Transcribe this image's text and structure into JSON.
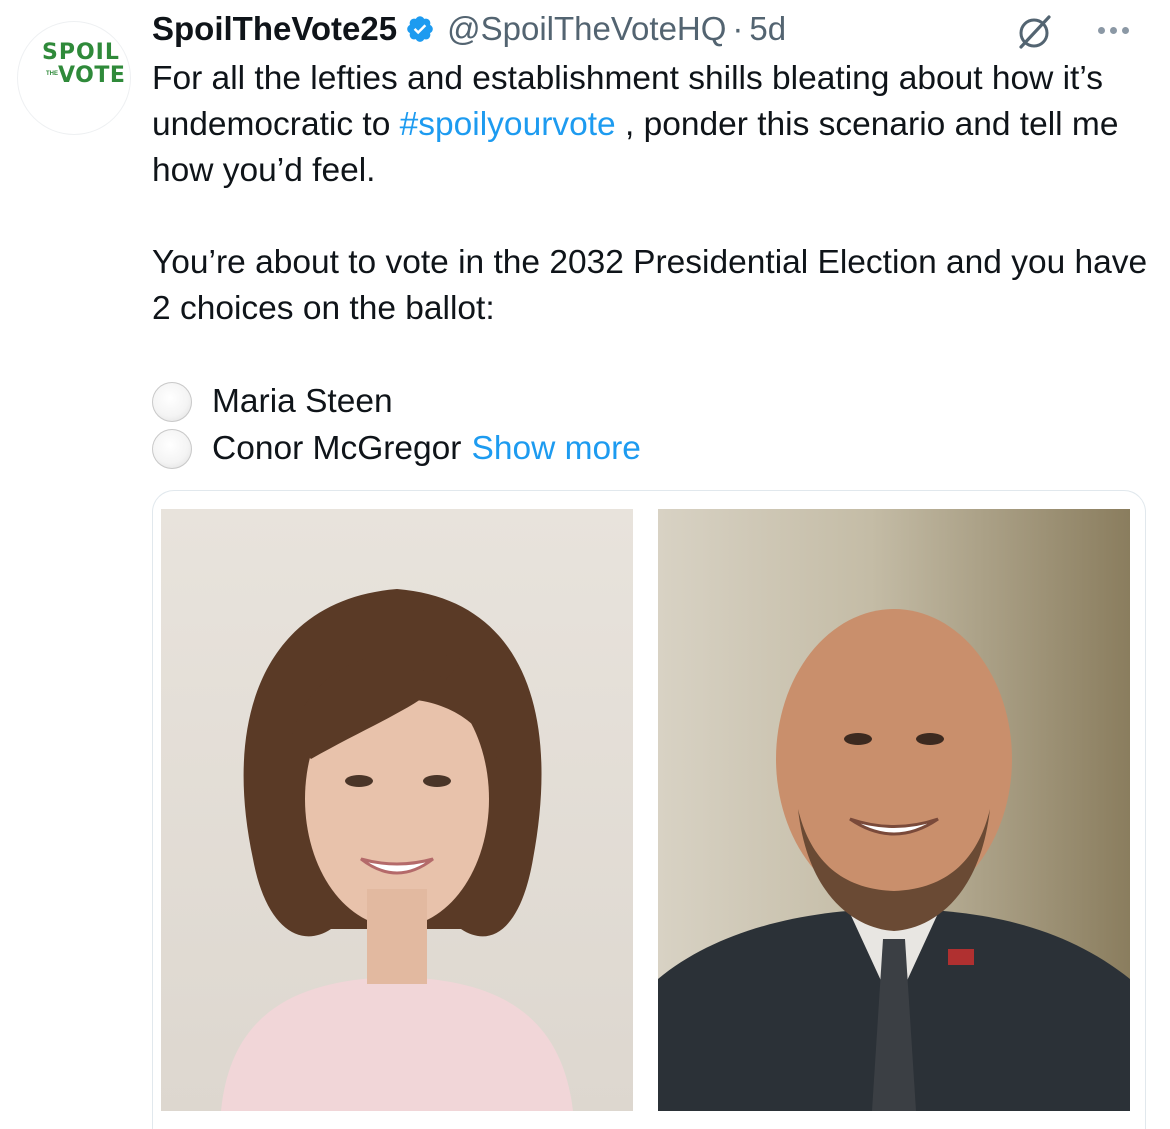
{
  "account": {
    "avatar_line1": "SPOIL",
    "avatar_small": "THE",
    "avatar_line2": "VOTE",
    "display_name": "SpoilTheVote25",
    "handle": "@SpoilTheVoteHQ",
    "separator": "·",
    "time": "5d",
    "verified_icon": "verified-badge-icon",
    "grok_icon": "grok-icon",
    "more_icon": "more-options-icon"
  },
  "tweet": {
    "p1_before": "For all the lefties and establishment shills bleating about how it’s undemocratic to ",
    "hashtag": "#spoilyourvote",
    "p1_after": " , ponder this scenario and tell me how you’d feel.",
    "p2": "You’re about to vote in the 2032 Presidential Election and you have 2 choices on the ballot:",
    "options": [
      "Maria Steen",
      "Conor McGregor"
    ],
    "show_more": "Show more"
  },
  "colors": {
    "link": "#1d9bf0",
    "text": "#0f1419",
    "secondary": "#536471",
    "logo_green": "#2f8a3a"
  }
}
